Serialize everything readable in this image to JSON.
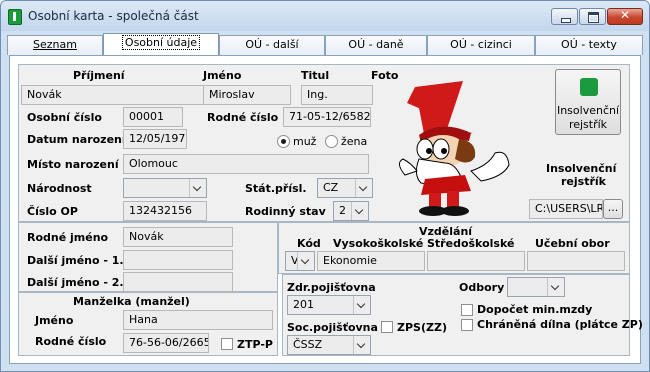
{
  "window": {
    "title": "Osobní karta - společná část"
  },
  "tabs": [
    {
      "label": "Seznam"
    },
    {
      "label": "Osobní údaje"
    },
    {
      "label": "OÚ - další"
    },
    {
      "label": "OÚ - daně"
    },
    {
      "label": "OÚ - cizinci"
    },
    {
      "label": "OÚ - texty"
    }
  ],
  "personal": {
    "prijmeni_label": "Příjmení",
    "jmeno_label": "Jméno",
    "titul_label": "Titul",
    "foto_label": "Foto",
    "prijmeni": "Novák",
    "jmeno": "Miroslav",
    "titul": "Ing.",
    "osobni_cislo_label": "Osobní číslo",
    "osobni_cislo": "00001",
    "rodne_cislo_label": "Rodné číslo",
    "rodne_cislo": "71-05-12/6582",
    "datum_narozeni_label": "Datum narození",
    "datum_narozeni": "12/05/1971",
    "muz_label": "muž",
    "zena_label": "žena",
    "misto_narozeni_label": "Místo narození",
    "misto_narozeni": "Olomouc",
    "narodnost_label": "Národnost",
    "narodnost": "",
    "stat_prisl_label": "Stát.přísl.",
    "stat_prisl": "CZ",
    "cislo_op_label": "Číslo OP",
    "cislo_op": "132432156",
    "rodinny_stav_label": "Rodinný stav",
    "rodinny_stav": "2"
  },
  "insolvency": {
    "button_label_1": "Insolvenční",
    "button_label_2": "rejstřík",
    "heading_1": "Insolvenční",
    "heading_2": "rejstřík",
    "path": "C:\\USERS\\LR",
    "browse_label": "..."
  },
  "names": {
    "rodne_jmeno_label": "Rodné jméno",
    "rodne_jmeno": "Novák",
    "dalsi1_label": "Další jméno - 1.",
    "dalsi1": "",
    "dalsi2_label": "Další jméno - 2.",
    "dalsi2": ""
  },
  "education": {
    "heading": "Vzdělání",
    "kod_label": "Kód",
    "vs_label": "Vysokoškolské",
    "ss_label": "Středoškolské",
    "uo_label": "Učební obor",
    "kod": "V",
    "vs": "Ekonomie",
    "ss": "",
    "uo": ""
  },
  "spouse": {
    "heading": "Manželka (manžel)",
    "jmeno_label": "Jméno",
    "jmeno": "Hana",
    "rodne_cislo_label": "Rodné číslo",
    "rodne_cislo": "76-56-06/2665",
    "ztp_label": "ZTP-P"
  },
  "insurance": {
    "zdr_label": "Zdr.pojišťovna",
    "zdr": "201",
    "soc_label": "Soc.pojišťovna",
    "soc": "ČSSZ",
    "zps_label": "ZPS(ZZ)",
    "odbory_label": "Odbory",
    "odbory": "",
    "dopocet_label": "Dopočet min.mzdy",
    "dilna_label": "Chráněná dílna (plátce ZP)"
  },
  "colors": {
    "accent": "#cfe0f1",
    "close": "#c9462f",
    "mascot_red": "#d01a1a"
  }
}
